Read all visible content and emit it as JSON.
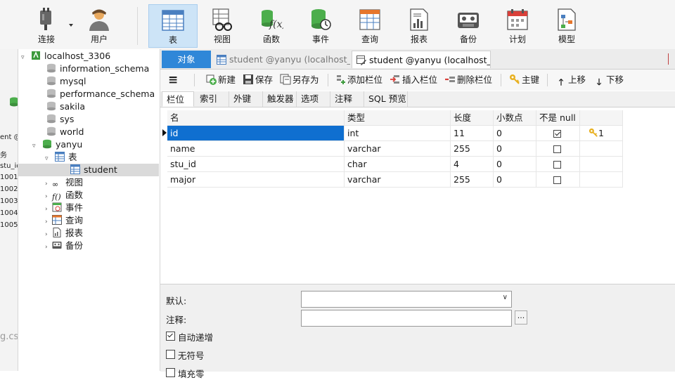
{
  "toolbar": {
    "items": [
      {
        "label": "连接",
        "icon": "plug-icon"
      },
      {
        "label": "用户",
        "icon": "user-icon"
      },
      {
        "label": "表",
        "icon": "table-icon"
      },
      {
        "label": "视图",
        "icon": "view-icon"
      },
      {
        "label": "函数",
        "icon": "function-icon"
      },
      {
        "label": "事件",
        "icon": "event-icon"
      },
      {
        "label": "查询",
        "icon": "query-icon"
      },
      {
        "label": "报表",
        "icon": "report-icon"
      },
      {
        "label": "备份",
        "icon": "backup-icon"
      },
      {
        "label": "计划",
        "icon": "schedule-icon"
      },
      {
        "label": "模型",
        "icon": "model-icon"
      }
    ],
    "active": "表"
  },
  "left_fragment": {
    "texts": [
      "ent @",
      "务",
      "stu_id",
      "1001",
      "1002",
      "1003",
      "1004",
      "1005",
      "g.cs"
    ]
  },
  "tree": {
    "connection": "localhost_3306",
    "databases": [
      "information_schema",
      "mysql",
      "performance_schema",
      "sakila",
      "sys",
      "world"
    ],
    "open_db": "yanyu",
    "tables_label": "表",
    "selected_table": "student",
    "groups": [
      "视图",
      "函数",
      "事件",
      "查询",
      "报表",
      "备份"
    ]
  },
  "tabs": {
    "objects": "对象",
    "tab1": "student @yanyu (localhost_...",
    "tab2": "student @yanyu (localhost_..."
  },
  "actions": {
    "menu": "≡",
    "new": "新建",
    "save": "保存",
    "save_as": "另存为",
    "add_field": "添加栏位",
    "insert_field": "插入栏位",
    "delete_field": "删除栏位",
    "primary_key": "主键",
    "move_up": "上移",
    "move_down": "下移"
  },
  "subtabs": [
    "栏位",
    "索引",
    "外键",
    "触发器",
    "选项",
    "注释",
    "SQL 预览"
  ],
  "grid": {
    "headers": [
      "名",
      "类型",
      "长度",
      "小数点",
      "不是 null",
      ""
    ],
    "rows": [
      {
        "name": "id",
        "type": "int",
        "length": "11",
        "decimals": "0",
        "not_null": true,
        "key": "1"
      },
      {
        "name": "name",
        "type": "varchar",
        "length": "255",
        "decimals": "0",
        "not_null": false,
        "key": ""
      },
      {
        "name": "stu_id",
        "type": "char",
        "length": "4",
        "decimals": "0",
        "not_null": false,
        "key": ""
      },
      {
        "name": "major",
        "type": "varchar",
        "length": "255",
        "decimals": "0",
        "not_null": false,
        "key": ""
      }
    ]
  },
  "bottom": {
    "default_label": "默认:",
    "comment_label": "注释:",
    "ellipsis": "...",
    "auto_increment": "自动递增",
    "auto_increment_checked": true,
    "unsigned": "无符号",
    "unsigned_checked": false,
    "zerofill": "填充零"
  },
  "colors": {
    "accent": "#2f87d8",
    "selection": "#0f6fd0",
    "tree_selected": "#dadada",
    "toolbar_active": "#cde4f7"
  }
}
